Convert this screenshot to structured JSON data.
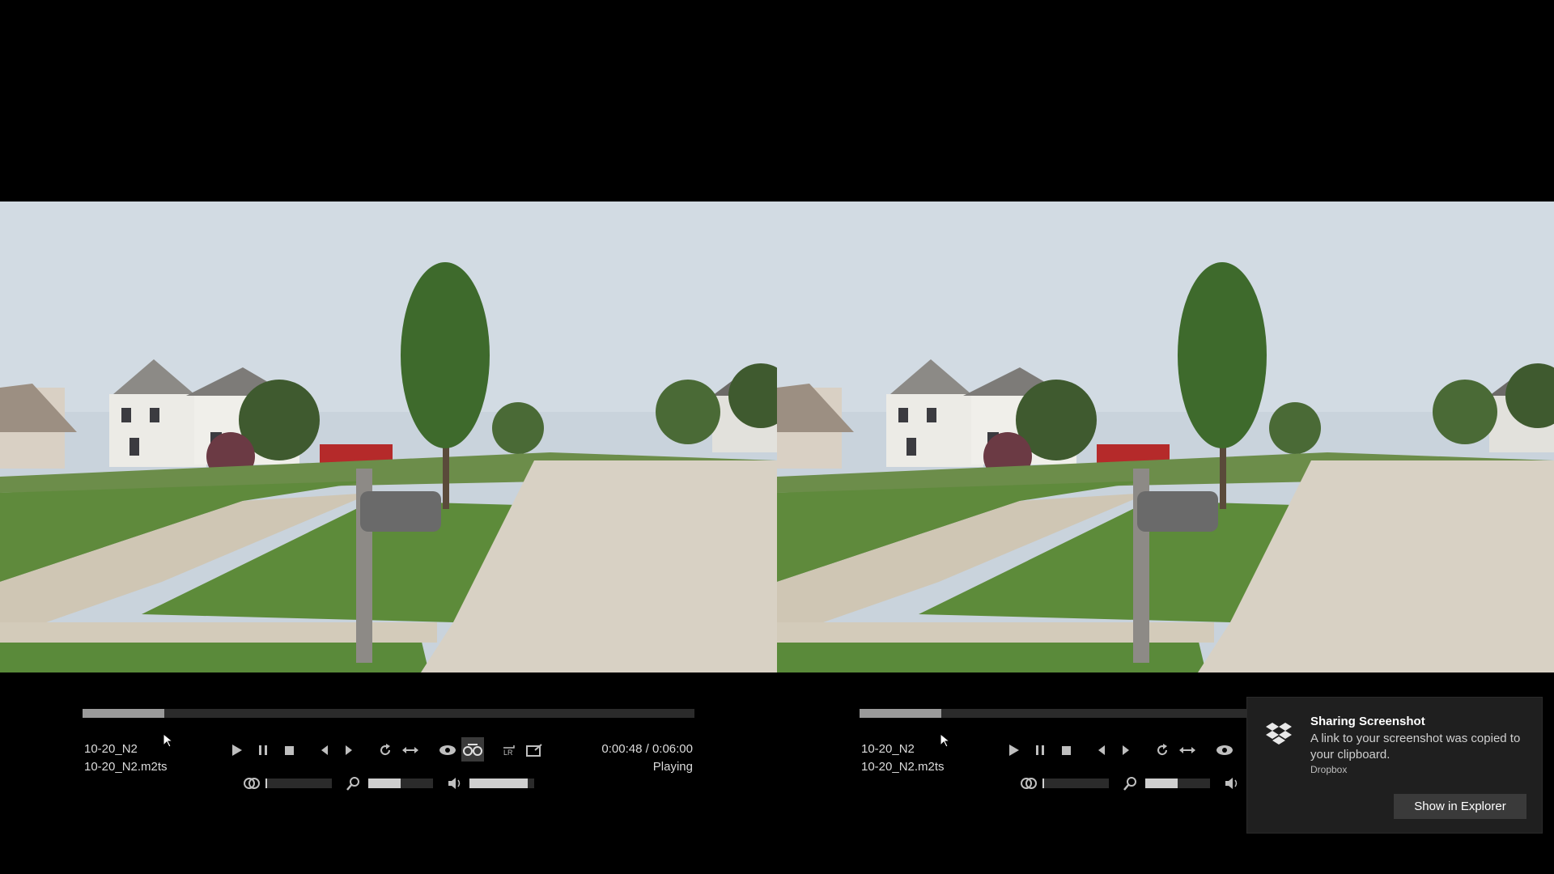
{
  "players": [
    {
      "title": "10-20_N2",
      "filename": "10-20_N2.m2ts",
      "time": "0:00:48 / 0:06:00",
      "status": "Playing",
      "progress": 0.1333,
      "parallax_level": 0.02,
      "zoom_level": 0.5,
      "volume_level": 0.9
    },
    {
      "title": "10-20_N2",
      "filename": "10-20_N2.m2ts",
      "progress": 0.1333,
      "parallax_level": 0.02,
      "zoom_level": 0.5
    }
  ],
  "icons": {
    "play": "play-icon",
    "pause": "pause-icon",
    "stop": "stop-icon",
    "prev": "previous-frame-icon",
    "next": "next-frame-icon",
    "repeat": "repeat-icon",
    "swap": "swap-eyes-icon",
    "view": "eye-icon",
    "anaglyph": "glasses-icon",
    "lr": "left-right-icon",
    "fullscreen": "fullscreen-icon",
    "parallax": "parallax-icon",
    "zoom": "zoom-icon",
    "volume": "volume-icon"
  },
  "notification": {
    "title": "Sharing Screenshot",
    "message": "A link to your screenshot was copied to your clipboard.",
    "app": "Dropbox",
    "button": "Show in Explorer"
  },
  "colors": {
    "background": "#000000",
    "toast_bg": "#1f1f1f",
    "toast_button": "#3a3a3a"
  }
}
